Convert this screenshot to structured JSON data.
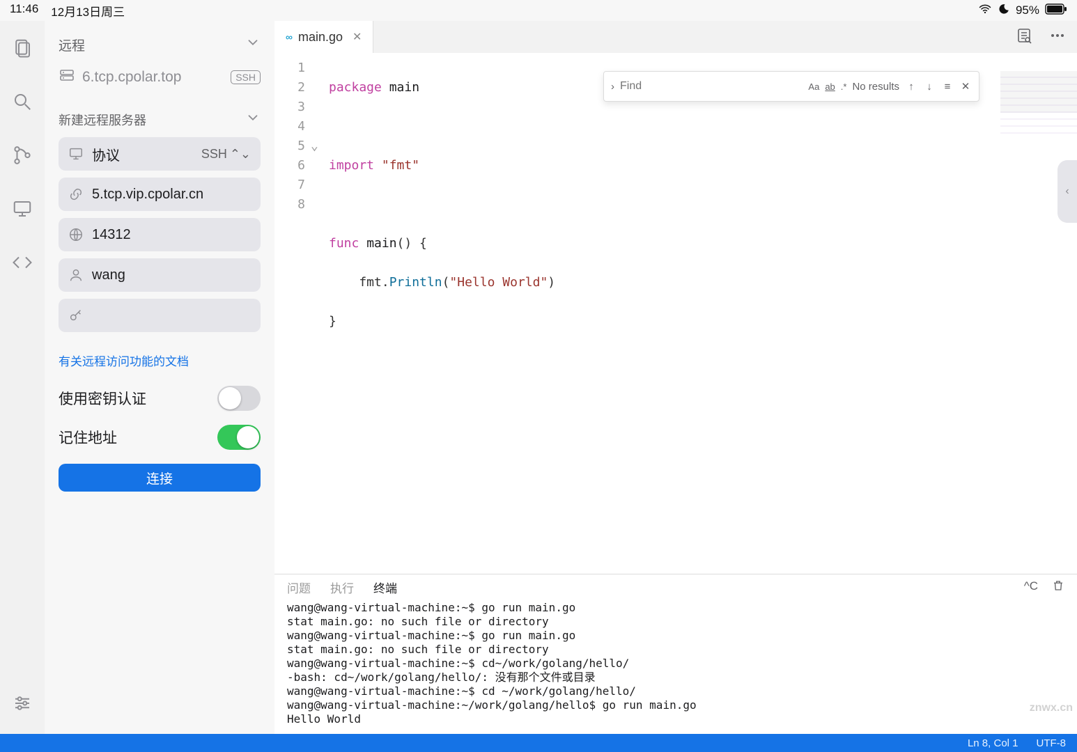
{
  "status": {
    "time": "11:46",
    "date": "12月13日周三",
    "battery": "95%"
  },
  "rail_icons": [
    "files",
    "search",
    "source-control",
    "remote",
    "code",
    "settings"
  ],
  "sidebar": {
    "header": "远程",
    "server_display": "6.tcp.cpolar.top",
    "server_badge": "SSH",
    "section_title": "新建远程服务器",
    "fields": {
      "protocol_label": "协议",
      "protocol_value": "SSH",
      "host": "5.tcp.vip.cpolar.cn",
      "port": "14312",
      "user": "wang",
      "key": ""
    },
    "doc_link": "有关远程访问功能的文档",
    "switch_key_auth": "使用密钥认证",
    "switch_remember": "记住地址",
    "connect": "连接"
  },
  "tab": {
    "filename": "main.go",
    "icon": "∞"
  },
  "find": {
    "placeholder": "Find",
    "results": "No results",
    "opt_case": "Aa",
    "opt_word": "ab",
    "opt_regex": ".*"
  },
  "gutter": [
    "1",
    "2",
    "3",
    "4",
    "5",
    "6",
    "7",
    "8"
  ],
  "code": {
    "l1a": "package",
    "l1b": " main",
    "l3a": "import",
    "l3b": " \"fmt\"",
    "l5a": "func",
    "l5b": " main",
    "l5c": "() {",
    "l6a": "    fmt.",
    "l6b": "Println",
    "l6c": "(",
    "l6d": "\"Hello World\"",
    "l6e": ")",
    "l7": "}"
  },
  "panel": {
    "tabs": {
      "problems": "问题",
      "run": "执行",
      "terminal": "终端"
    },
    "shortcut": "^C",
    "output": "wang@wang-virtual-machine:~$ go run main.go\nstat main.go: no such file or directory\nwang@wang-virtual-machine:~$ go run main.go\nstat main.go: no such file or directory\nwang@wang-virtual-machine:~$ cd~/work/golang/hello/\n-bash: cd~/work/golang/hello/: 没有那个文件或目录\nwang@wang-virtual-machine:~$ cd ~/work/golang/hello/\nwang@wang-virtual-machine:~/work/golang/hello$ go run main.go\nHello World"
  },
  "bottom": {
    "position": "Ln 8, Col 1",
    "encoding": "UTF-8"
  },
  "watermark": "znwx.cn"
}
